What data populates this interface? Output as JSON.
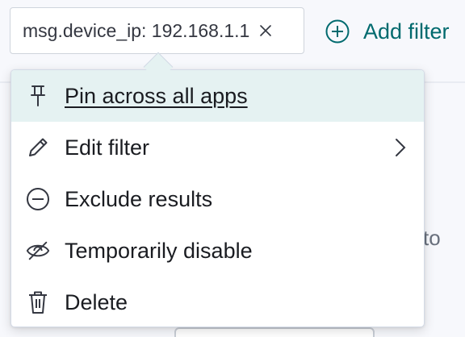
{
  "filter_pill": {
    "label": "msg.device_ip: 192.168.1.1",
    "close_icon": "close-icon"
  },
  "add_filter": {
    "label": "Add filter",
    "icon": "plus-circle-icon",
    "color": "#006a6e"
  },
  "background": {
    "partial_text": "to"
  },
  "context_menu": {
    "highlight_color": "#e5f2f2",
    "items": [
      {
        "label": "Pin across all apps",
        "icon": "pin-icon",
        "highlighted": true,
        "has_submenu": false
      },
      {
        "label": "Edit filter",
        "icon": "pencil-icon",
        "highlighted": false,
        "has_submenu": true
      },
      {
        "label": "Exclude results",
        "icon": "minus-circle-icon",
        "highlighted": false,
        "has_submenu": false
      },
      {
        "label": "Temporarily disable",
        "icon": "eye-closed-icon",
        "highlighted": false,
        "has_submenu": false
      },
      {
        "label": "Delete",
        "icon": "trash-icon",
        "highlighted": false,
        "has_submenu": false
      }
    ]
  }
}
